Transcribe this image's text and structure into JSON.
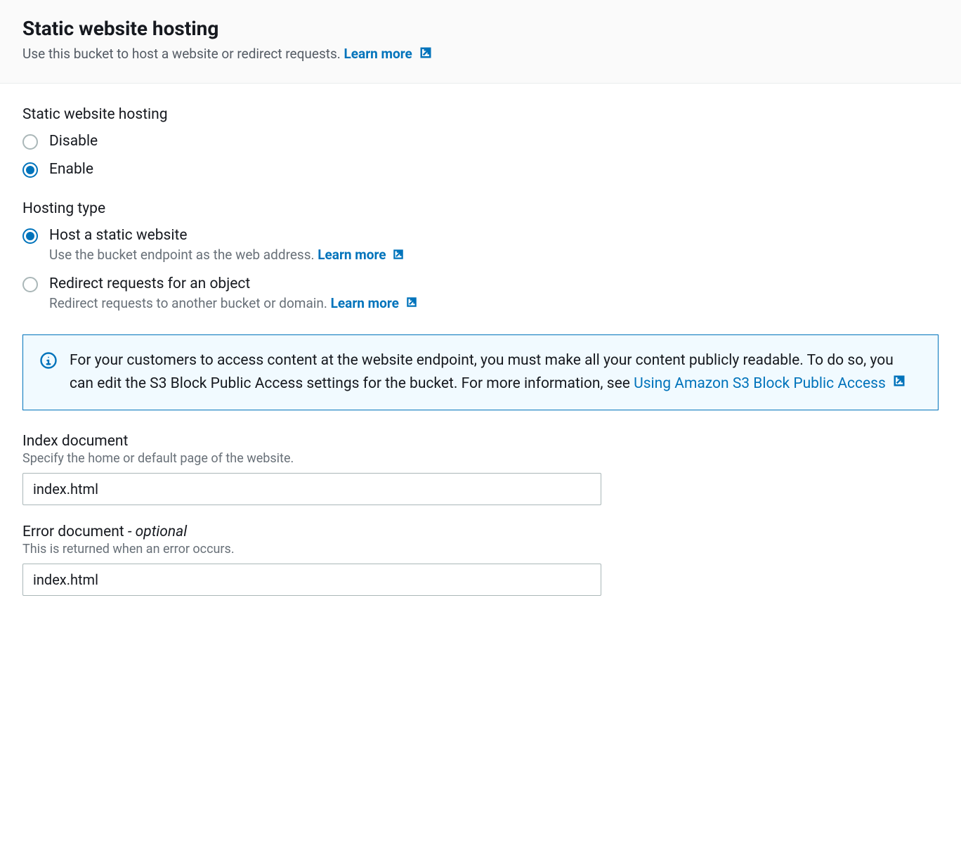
{
  "header": {
    "title": "Static website hosting",
    "description": "Use this bucket to host a website or redirect requests.",
    "learnMore": "Learn more"
  },
  "hostingToggle": {
    "label": "Static website hosting",
    "options": [
      {
        "label": "Disable",
        "selected": false
      },
      {
        "label": "Enable",
        "selected": true
      }
    ]
  },
  "hostingType": {
    "label": "Hosting type",
    "options": [
      {
        "label": "Host a static website",
        "description": "Use the bucket endpoint as the web address.",
        "learnMore": "Learn more",
        "selected": true
      },
      {
        "label": "Redirect requests for an object",
        "description": "Redirect requests to another bucket or domain.",
        "learnMore": "Learn more",
        "selected": false
      }
    ]
  },
  "infoBox": {
    "textBefore": "For your customers to access content at the website endpoint, you must make all your content publicly readable. To do so, you can edit the S3 Block Public Access settings for the bucket. For more information, see ",
    "linkText": "Using Amazon S3 Block Public Access"
  },
  "indexDocument": {
    "label": "Index document",
    "hint": "Specify the home or default page of the website.",
    "value": "index.html"
  },
  "errorDocument": {
    "labelPrefix": "Error document",
    "labelSuffix": " - optional",
    "hint": "This is returned when an error occurs.",
    "value": "index.html"
  }
}
